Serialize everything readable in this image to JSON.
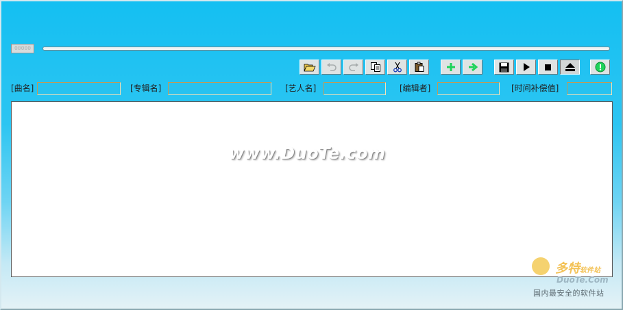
{
  "player": {
    "time_display": "00000",
    "seek_progress": 0
  },
  "toolbar": {
    "buttons": [
      {
        "name": "open",
        "icon": "folder-open-icon",
        "enabled": true
      },
      {
        "name": "undo",
        "icon": "undo-icon",
        "enabled": false
      },
      {
        "name": "redo",
        "icon": "redo-icon",
        "enabled": false
      },
      {
        "name": "copy",
        "icon": "copy-icon",
        "enabled": true
      },
      {
        "name": "cut",
        "icon": "scissors-icon",
        "enabled": true
      },
      {
        "name": "paste",
        "icon": "paste-icon",
        "enabled": true
      },
      {
        "name": "add-tag",
        "icon": "plus-icon",
        "enabled": true
      },
      {
        "name": "next-tag",
        "icon": "arrow-right-icon",
        "enabled": true
      },
      {
        "name": "save",
        "icon": "floppy-disk-icon",
        "enabled": true
      },
      {
        "name": "play",
        "icon": "play-icon",
        "enabled": true
      },
      {
        "name": "stop",
        "icon": "stop-icon",
        "enabled": true
      },
      {
        "name": "eject",
        "icon": "eject-icon",
        "enabled": true,
        "pressed": true
      },
      {
        "name": "help",
        "icon": "help-circle-icon",
        "enabled": true
      }
    ]
  },
  "fields": {
    "title_label": "[曲名]",
    "title_value": "",
    "album_label": "[专辑名]",
    "album_value": "",
    "artist_label": "[艺人名]",
    "artist_value": "",
    "editor_label": "[编辑者]",
    "editor_value": "",
    "offset_label": "[时间补偿值]",
    "offset_value": ""
  },
  "lyrics_editor": {
    "content": ""
  },
  "watermark": {
    "center_text": "www.DuoTe.com",
    "corner_brand_cn": "多特",
    "corner_brand_small": "软件站",
    "corner_brand_en": "DuoTe.Com",
    "corner_slogan": "国内最安全的软件站"
  },
  "colors": {
    "accent_green": "#1fd35a",
    "field_bg": "#27c2f0",
    "field_border": "#c19b56"
  }
}
